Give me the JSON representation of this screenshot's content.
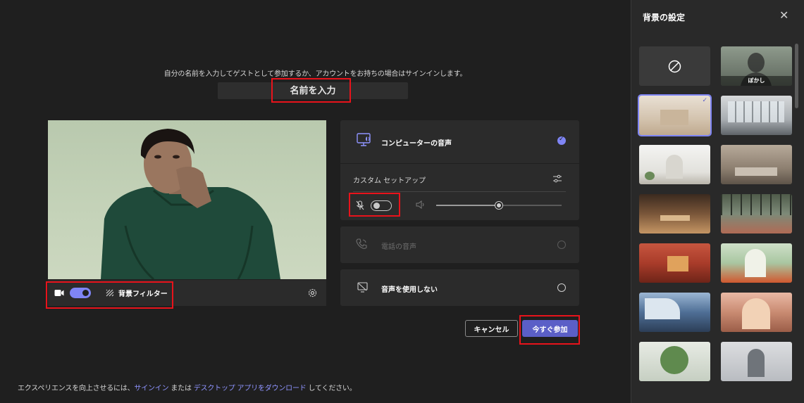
{
  "main": {
    "instruction": "自分の名前を入力してゲストとして参加するか、アカウントをお持ちの場合はサインインします。",
    "name_placeholder": "名前を入力",
    "video_controls": {
      "background_filter_label": "背景フィルター"
    },
    "audio_options": {
      "computer_audio": {
        "label": "コンピューターの音声",
        "selected": true
      },
      "custom_setup_label": "カスタム セットアップ",
      "phone_audio": {
        "label": "電話の音声",
        "enabled": false
      },
      "no_audio": {
        "label": "音声を使用しない"
      }
    },
    "mic_toggle_on": false,
    "camera_toggle_on": true,
    "volume_level": 0.5,
    "buttons": {
      "cancel": "キャンセル",
      "join_now": "今すぐ参加"
    },
    "footer": {
      "prefix": "エクスペリエンスを向上させるには、",
      "sign_in": "サインイン",
      "or": " または ",
      "download": "デスクトップ アプリをダウンロード",
      "suffix": " してください。"
    }
  },
  "side_panel": {
    "title": "背景の設定",
    "blur_label": "ぼかし",
    "close_icon": "close-icon",
    "selected_index": 2
  },
  "colors": {
    "accent": "#7f85f5",
    "join_button": "#5b5fc7",
    "highlight_red": "#e8131b",
    "link": "#8f94ff"
  }
}
